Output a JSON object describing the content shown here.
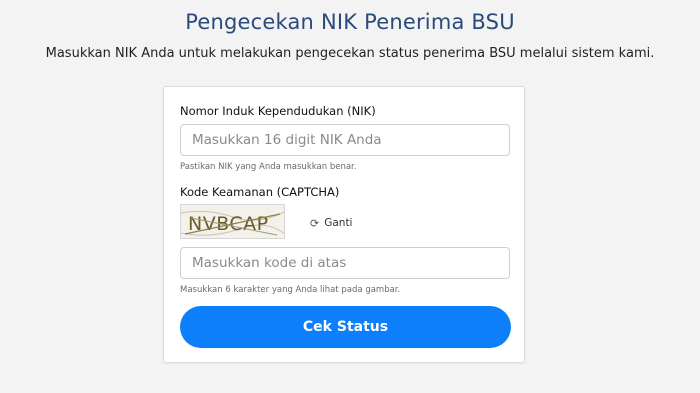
{
  "header": {
    "title": "Pengecekan NIK Penerima BSU",
    "subtitle": "Masukkan NIK Anda untuk melakukan pengecekan status penerima BSU melalui sistem kami."
  },
  "form": {
    "nik_label": "Nomor Induk Kependudukan (NIK)",
    "nik_placeholder": "Masukkan 16 digit NIK Anda",
    "nik_value": "",
    "nik_help": "Pastikan NIK yang Anda masukkan benar.",
    "captcha_label": "Kode Keamanan (CAPTCHA)",
    "captcha_text": "NVBCAP",
    "refresh_label": "Ganti",
    "refresh_icon": "refresh-icon",
    "captcha_placeholder": "Masukkan kode di atas",
    "captcha_value": "",
    "captcha_help": "Masukkan 6 karakter yang Anda lihat pada gambar.",
    "submit_label": "Cek Status"
  },
  "colors": {
    "title": "#2a4a7c",
    "primary_button": "#0d7ffb",
    "background": "#f3f3f3"
  }
}
